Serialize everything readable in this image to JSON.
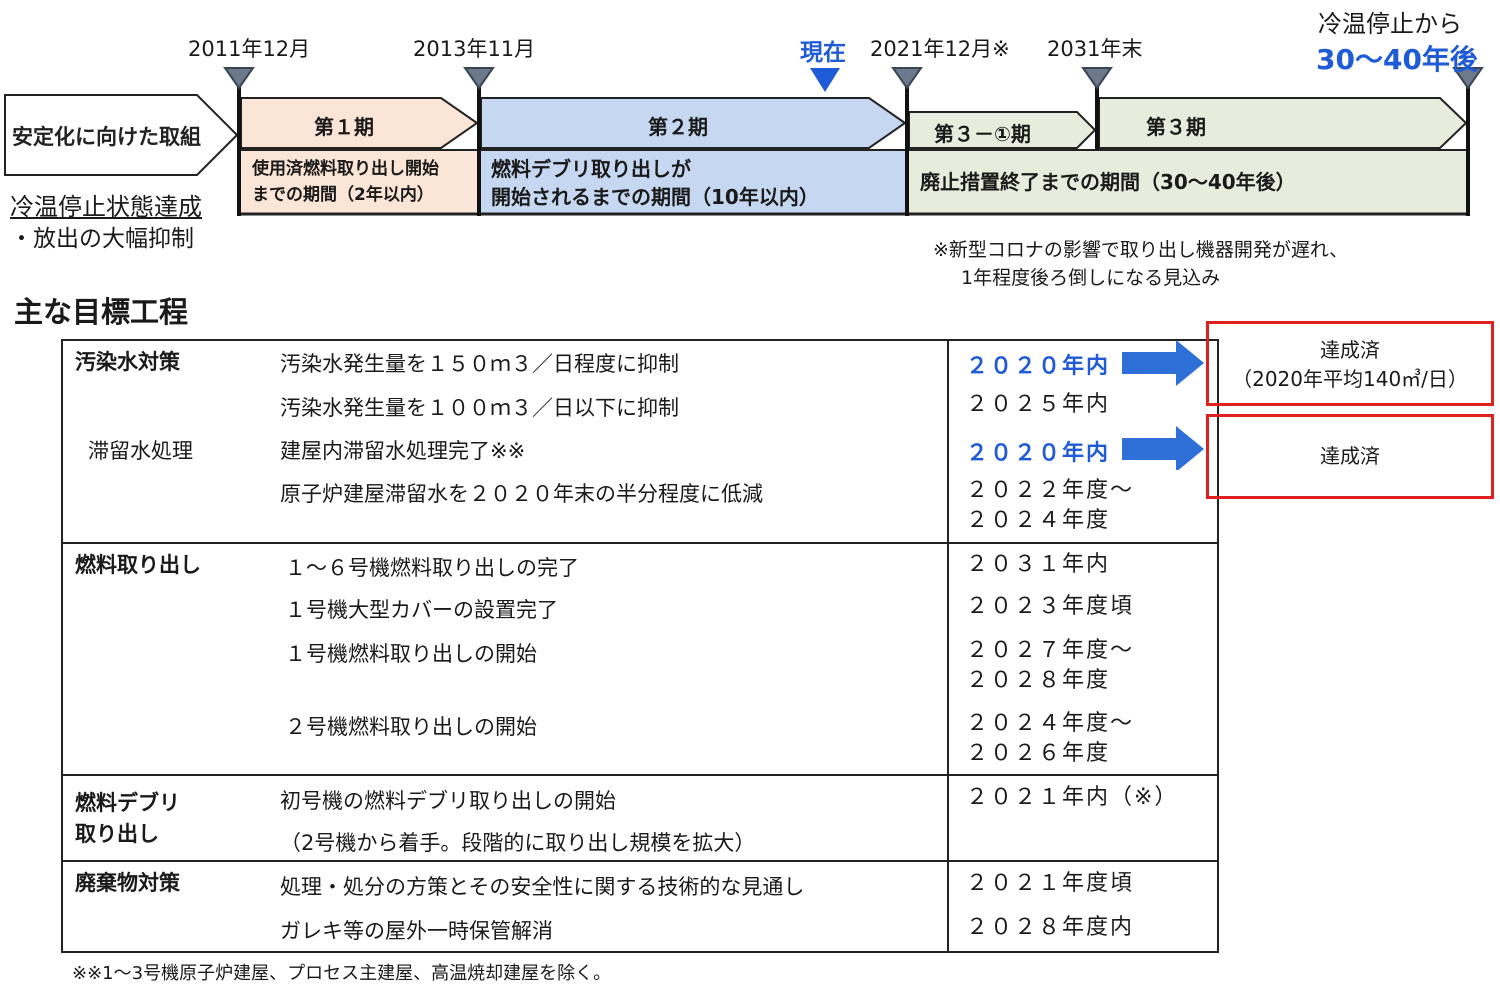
{
  "colors": {
    "accent_blue": "#1f5bd6",
    "phase1_fill": "#fbe5d6",
    "phase2_fill": "#c5d7f1",
    "phase3_fill": "#e8ecdc",
    "marker_fill": "#6c7a8c",
    "achieved_border": "#e02020",
    "arrow_blue": "#2e6fd8"
  },
  "timeline": {
    "dates": {
      "d2011": "2011年12月",
      "d2013": "2013年11月",
      "d2021": "2021年12月※",
      "d2031": "2031年末"
    },
    "now_label": "現在",
    "target_line1": "冷温停止から",
    "target_line2": "30～40年後",
    "start_label": "安定化に向けた取組",
    "phases": {
      "p1": "第１期",
      "p2": "第２期",
      "p31": "第３－①期",
      "p3": "第３期"
    },
    "periods": {
      "p1_line1": "使用済燃料取り出し開始",
      "p1_line2": "までの期間（2年以内）",
      "p2_line1": "燃料デブリ取り出しが",
      "p2_line2": "開始されるまでの期間（10年以内）",
      "p3": "廃止措置終了までの期間（30～40年後）"
    },
    "stabilization": "冷温停止状態達成",
    "suppression": "・放出の大幅抑制",
    "note_line1": "※新型コロナの影響で取り出し機器開発が遅れ、",
    "note_line2": "1年程度後ろ倒しになる見込み"
  },
  "goals": {
    "heading": "主な目標工程",
    "sections": {
      "water": {
        "category": "汚染水対策",
        "subcategory": "滞留水処理",
        "items": [
          "汚染水発生量を１５０ｍ３／日程度に抑制",
          "汚染水発生量を１００ｍ３／日以下に抑制",
          "建屋内滞留水処理完了※※",
          "原子炉建屋滞留水を２０２０年末の半分程度に低減"
        ],
        "due": [
          "２０２０年内",
          "２０２５年内",
          "２０２０年内",
          "２０２２年度～",
          "２０２４年度"
        ]
      },
      "fuel": {
        "category": "燃料取り出し",
        "items": [
          "１～６号機燃料取り出しの完了",
          "１号機大型カバーの設置完了",
          "１号機燃料取り出しの開始",
          "２号機燃料取り出しの開始"
        ],
        "due": [
          "２０３１年内",
          "２０２３年度頃",
          "２０２７年度～",
          "２０２８年度",
          "２０２４年度～",
          "２０２６年度"
        ]
      },
      "debris": {
        "category_line1": "燃料デブリ",
        "category_line2": "取り出し",
        "items": [
          "初号機の燃料デブリ取り出しの開始",
          "（2号機から着手。段階的に取り出し規模を拡大）"
        ],
        "due": [
          "２０２１年内（※）"
        ]
      },
      "waste": {
        "category": "廃棄物対策",
        "items": [
          "処理・処分の方策とその安全性に関する技術的な見通し",
          "ガレキ等の屋外一時保管解消"
        ],
        "due": [
          "２０２１年度頃",
          "２０２８年度内"
        ]
      }
    },
    "achieved1_line1": "達成済",
    "achieved1_line2": "（2020年平均140㎥/日）",
    "achieved2": "達成済",
    "footnote": "※※1～3号機原子炉建屋、プロセス主建屋、高温焼却建屋を除く。"
  }
}
